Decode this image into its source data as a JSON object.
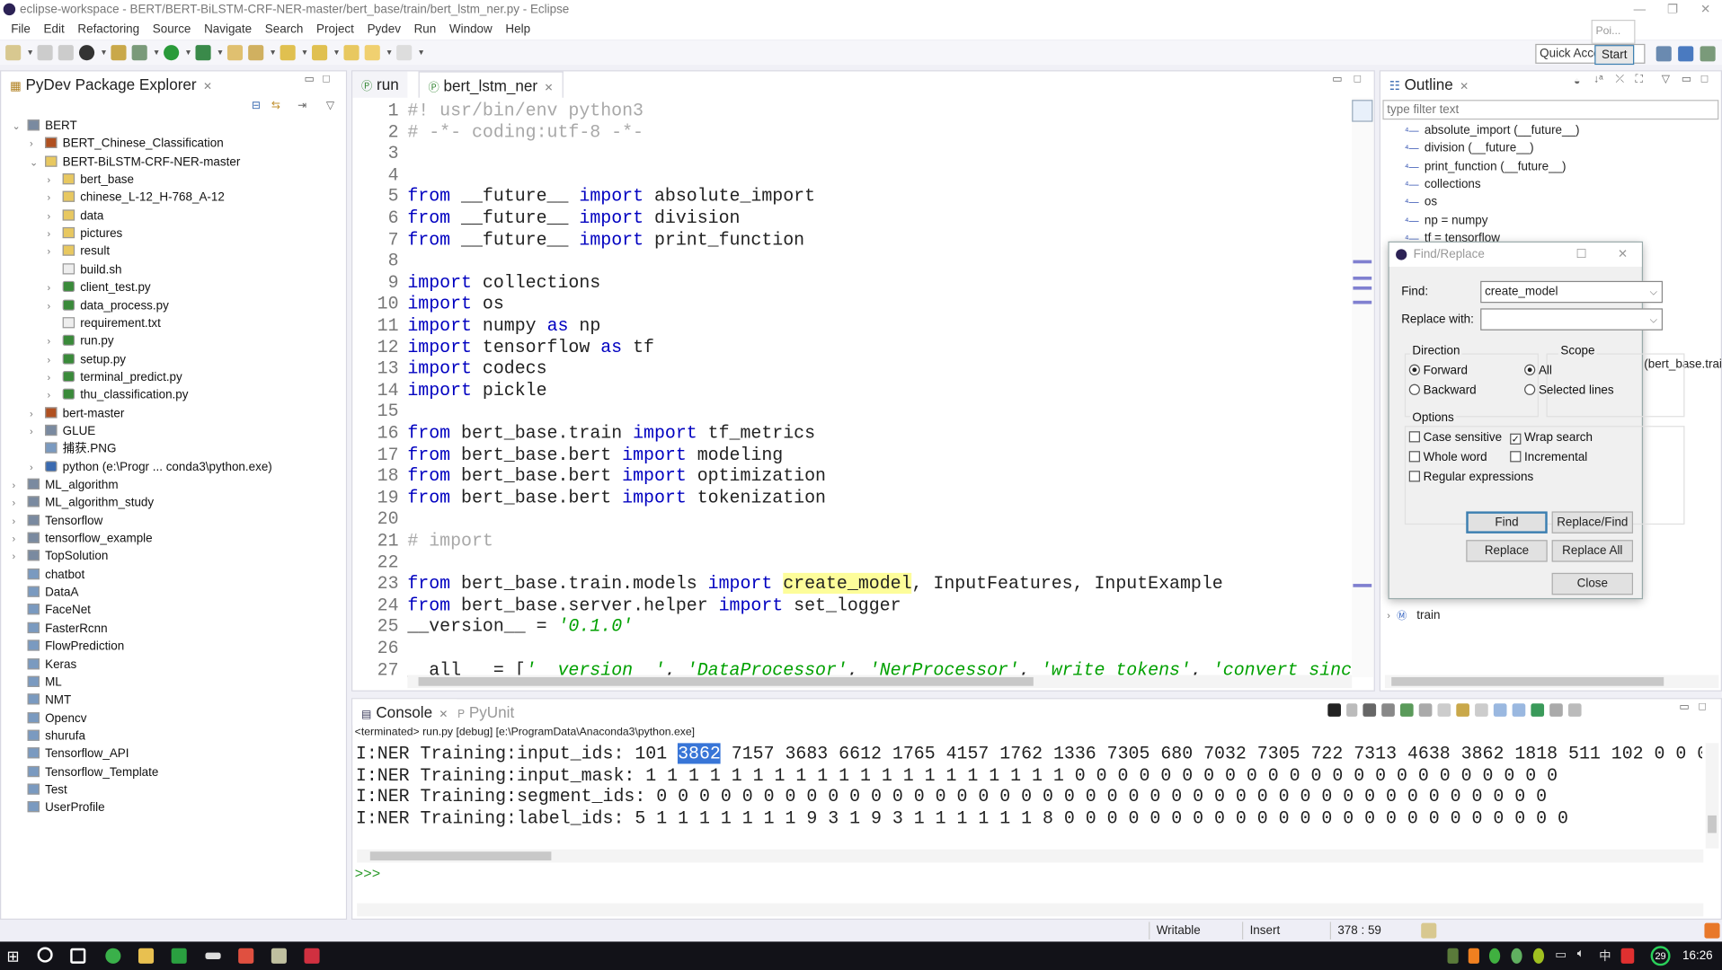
{
  "window": {
    "title": "eclipse-workspace - BERT/BERT-BiLSTM-CRF-NER-master/bert_base/train/bert_lstm_ner.py - Eclipse"
  },
  "menu": [
    "File",
    "Edit",
    "Refactoring",
    "Source",
    "Navigate",
    "Search",
    "Project",
    "Pydev",
    "Run",
    "Window",
    "Help"
  ],
  "toolbar": {
    "quick_access_placeholder": "Quick Access",
    "popup_label": "Poi...",
    "start_button": "Start"
  },
  "explorer": {
    "title": "PyDev Package Explorer",
    "items": [
      {
        "label": "BERT",
        "level": 0,
        "type": "project",
        "expanded": true
      },
      {
        "label": "BERT_Chinese_Classification",
        "level": 1,
        "type": "package"
      },
      {
        "label": "BERT-BiLSTM-CRF-NER-master",
        "level": 1,
        "type": "folder",
        "expanded": true
      },
      {
        "label": "bert_base",
        "level": 2,
        "type": "folder"
      },
      {
        "label": "chinese_L-12_H-768_A-12",
        "level": 2,
        "type": "folder"
      },
      {
        "label": "data",
        "level": 2,
        "type": "folder"
      },
      {
        "label": "pictures",
        "level": 2,
        "type": "folder"
      },
      {
        "label": "result",
        "level": 2,
        "type": "folder"
      },
      {
        "label": "build.sh",
        "level": 2,
        "type": "file",
        "leaf": true
      },
      {
        "label": "client_test.py",
        "level": 2,
        "type": "py"
      },
      {
        "label": "data_process.py",
        "level": 2,
        "type": "py"
      },
      {
        "label": "requirement.txt",
        "level": 2,
        "type": "file",
        "leaf": true
      },
      {
        "label": "run.py",
        "level": 2,
        "type": "py"
      },
      {
        "label": "setup.py",
        "level": 2,
        "type": "py"
      },
      {
        "label": "terminal_predict.py",
        "level": 2,
        "type": "py"
      },
      {
        "label": "thu_classification.py",
        "level": 2,
        "type": "py"
      },
      {
        "label": "bert-master",
        "level": 1,
        "type": "package"
      },
      {
        "label": "GLUE",
        "level": 1,
        "type": "project"
      },
      {
        "label": "捕获.PNG",
        "level": 1,
        "type": "image",
        "leaf": true
      },
      {
        "label": "python  (e:\\Progr ... conda3\\python.exe)",
        "level": 1,
        "type": "python"
      },
      {
        "label": "ML_algorithm",
        "level": 0,
        "type": "project"
      },
      {
        "label": "ML_algorithm_study",
        "level": 0,
        "type": "project"
      },
      {
        "label": "Tensorflow",
        "level": 0,
        "type": "project"
      },
      {
        "label": "tensorflow_example",
        "level": 0,
        "type": "project"
      },
      {
        "label": "TopSolution",
        "level": 0,
        "type": "project"
      },
      {
        "label": "chatbot",
        "level": 0,
        "type": "closed",
        "leaf": true
      },
      {
        "label": "DataA",
        "level": 0,
        "type": "closed",
        "leaf": true
      },
      {
        "label": "FaceNet",
        "level": 0,
        "type": "closed",
        "leaf": true
      },
      {
        "label": "FasterRcnn",
        "level": 0,
        "type": "closed",
        "leaf": true
      },
      {
        "label": "FlowPrediction",
        "level": 0,
        "type": "closed",
        "leaf": true
      },
      {
        "label": "Keras",
        "level": 0,
        "type": "closed",
        "leaf": true
      },
      {
        "label": "ML",
        "level": 0,
        "type": "closed",
        "leaf": true
      },
      {
        "label": "NMT",
        "level": 0,
        "type": "closed",
        "leaf": true
      },
      {
        "label": "Opencv",
        "level": 0,
        "type": "closed",
        "leaf": true
      },
      {
        "label": "shurufa",
        "level": 0,
        "type": "closed",
        "leaf": true
      },
      {
        "label": "Tensorflow_API",
        "level": 0,
        "type": "closed",
        "leaf": true
      },
      {
        "label": "Tensorflow_Template",
        "level": 0,
        "type": "closed",
        "leaf": true
      },
      {
        "label": "Test",
        "level": 0,
        "type": "closed",
        "leaf": true
      },
      {
        "label": "UserProfile",
        "level": 0,
        "type": "closed",
        "leaf": true
      }
    ]
  },
  "editor": {
    "tabs": [
      {
        "label": "run",
        "active": false
      },
      {
        "label": "bert_lstm_ner",
        "active": true
      }
    ],
    "lines": [
      [
        [
          "cm",
          "#! usr/bin/env python3"
        ]
      ],
      [
        [
          "cm",
          "# -*- coding:utf-8 -*-"
        ]
      ],
      [],
      [],
      [
        [
          "kw",
          "from"
        ],
        [
          "p",
          " __future__ "
        ],
        [
          "kw",
          "import"
        ],
        [
          "p",
          " absolute_import"
        ]
      ],
      [
        [
          "kw",
          "from"
        ],
        [
          "p",
          " __future__ "
        ],
        [
          "kw",
          "import"
        ],
        [
          "p",
          " division"
        ]
      ],
      [
        [
          "kw",
          "from"
        ],
        [
          "p",
          " __future__ "
        ],
        [
          "kw",
          "import"
        ],
        [
          "p",
          " print_function"
        ]
      ],
      [],
      [
        [
          "kw",
          "import"
        ],
        [
          "p",
          " collections"
        ]
      ],
      [
        [
          "kw",
          "import"
        ],
        [
          "p",
          " os"
        ]
      ],
      [
        [
          "kw",
          "import"
        ],
        [
          "p",
          " numpy "
        ],
        [
          "kw",
          "as"
        ],
        [
          "p",
          " np"
        ]
      ],
      [
        [
          "kw",
          "import"
        ],
        [
          "p",
          " tensorflow "
        ],
        [
          "kw",
          "as"
        ],
        [
          "p",
          " tf"
        ]
      ],
      [
        [
          "kw",
          "import"
        ],
        [
          "p",
          " codecs"
        ]
      ],
      [
        [
          "kw",
          "import"
        ],
        [
          "p",
          " pickle"
        ]
      ],
      [],
      [
        [
          "kw",
          "from"
        ],
        [
          "p",
          " bert_base.train "
        ],
        [
          "kw",
          "import"
        ],
        [
          "p",
          " tf_metrics"
        ]
      ],
      [
        [
          "kw",
          "from"
        ],
        [
          "p",
          " bert_base.bert "
        ],
        [
          "kw",
          "import"
        ],
        [
          "p",
          " modeling"
        ]
      ],
      [
        [
          "kw",
          "from"
        ],
        [
          "p",
          " bert_base.bert "
        ],
        [
          "kw",
          "import"
        ],
        [
          "p",
          " optimization"
        ]
      ],
      [
        [
          "kw",
          "from"
        ],
        [
          "p",
          " bert_base.bert "
        ],
        [
          "kw",
          "import"
        ],
        [
          "p",
          " tokenization"
        ]
      ],
      [],
      [
        [
          "cm",
          "# import"
        ]
      ],
      [],
      [
        [
          "kw",
          "from"
        ],
        [
          "p",
          " bert_base.train.models "
        ],
        [
          "kw",
          "import"
        ],
        [
          "p",
          " "
        ],
        [
          "hl",
          "create_model"
        ],
        [
          "p",
          ", InputFeatures, InputExample"
        ]
      ],
      [
        [
          "kw",
          "from"
        ],
        [
          "p",
          " bert_base.server.helper "
        ],
        [
          "kw",
          "import"
        ],
        [
          "p",
          " set_logger"
        ]
      ],
      [
        [
          "p",
          "__version__ = "
        ],
        [
          "st",
          "'0.1.0'"
        ]
      ],
      [],
      [
        [
          "p",
          "__all__ = ["
        ],
        [
          "st",
          "'__version__'"
        ],
        [
          "p",
          ", "
        ],
        [
          "st",
          "'DataProcessor'"
        ],
        [
          "p",
          ", "
        ],
        [
          "st",
          "'NerProcessor'"
        ],
        [
          "p",
          ", "
        ],
        [
          "st",
          "'write_tokens'"
        ],
        [
          "p",
          ", "
        ],
        [
          "st",
          "'convert_sinc"
        ]
      ]
    ]
  },
  "outline": {
    "title": "Outline",
    "filter_placeholder": "type filter text",
    "items": [
      "absolute_import (__future__)",
      "division (__future__)",
      "print_function (__future__)",
      "collections",
      "os",
      "np = numpy",
      "tf = tensorflow"
    ],
    "partial_item": "(bert_base.train",
    "last_item": "train"
  },
  "console": {
    "tabs": [
      "Console",
      "PyUnit"
    ],
    "status": "<terminated> run.py [debug] [e:\\ProgramData\\Anaconda3\\python.exe]",
    "lines": [
      [
        "I:NER Training:input_ids: 101 ",
        "3862",
        " 7157 3683 6612 1765 4157 1762 1336 7305 680 7032 7305 722 7313 4638 3862 1818 511 102 0 0 0"
      ],
      [
        "I:NER Training:input_mask: 1 1 1 1 1 1 1 1 1 1 1 1 1 1 1 1 1 1 1 1 0 0 0 0 0 0 0 0 0 0 0 0 0 0 0 0 0 0 0 0 0 0 0"
      ],
      [
        "I:NER Training:segment_ids: 0 0 0 0 0 0 0 0 0 0 0 0 0 0 0 0 0 0 0 0 0 0 0 0 0 0 0 0 0 0 0 0 0 0 0 0 0 0 0 0 0 0"
      ],
      [
        "I:NER Training:label_ids: 5 1 1 1 1 1 1 1 9 3 1 9 3 1 1 1 1 1 1 8 0 0 0 0 0 0 0 0 0 0 0 0 0 0 0 0 0 0 0 0 0 0 0 0"
      ]
    ],
    "prompt": ">>>"
  },
  "status": {
    "writable": "Writable",
    "insert": "Insert",
    "position": "378 : 59"
  },
  "taskbar": {
    "time": "16:26",
    "badge": "29"
  },
  "find": {
    "title": "Find/Replace",
    "find_label": "Find:",
    "find_value": "create_model",
    "replace_label": "Replace with:",
    "replace_value": "",
    "direction_label": "Direction",
    "forward": "Forward",
    "backward": "Backward",
    "direction": "Forward",
    "scope_label": "Scope",
    "all": "All",
    "selected_lines": "Selected lines",
    "scope": "All",
    "options_label": "Options",
    "case_sensitive": "Case sensitive",
    "wrap_search": "Wrap search",
    "whole_word": "Whole word",
    "incremental": "Incremental",
    "regex": "Regular expressions",
    "checked": {
      "case_sensitive": false,
      "wrap_search": true,
      "whole_word": false,
      "incremental": false,
      "regex": false
    },
    "buttons": {
      "find": "Find",
      "replace_find": "Replace/Find",
      "replace": "Replace",
      "replace_all": "Replace All",
      "close": "Close"
    }
  },
  "colors": {
    "keyword": "#0000c0",
    "comment": "#a8a8a8",
    "string": "#00a000",
    "match_highlight": "#fdfd9a",
    "selection": "#3875d7"
  }
}
